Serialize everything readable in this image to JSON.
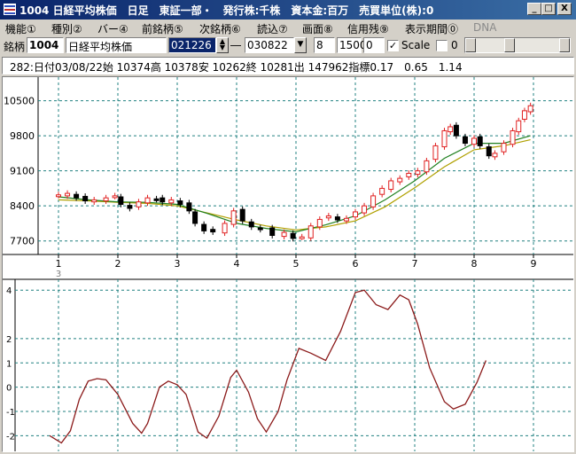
{
  "window": {
    "title": "1004 日経平均株価　日足　東証一部・　発行株:千株　資本金:百万　売買単位(株):0",
    "minimize": "_",
    "maximize": "□",
    "close": "X"
  },
  "menu": [
    {
      "label": "機能①",
      "disabled": false
    },
    {
      "label": "種別②",
      "disabled": false
    },
    {
      "label": "バー④",
      "disabled": false
    },
    {
      "label": "前銘柄⑤",
      "disabled": false
    },
    {
      "label": "次銘柄⑥",
      "disabled": false
    },
    {
      "label": "読込⑦",
      "disabled": false
    },
    {
      "label": "画面⑧",
      "disabled": false
    },
    {
      "label": "信用残⑨",
      "disabled": false
    },
    {
      "label": "表示期間⓪",
      "disabled": false
    },
    {
      "label": "DNA",
      "disabled": true
    }
  ],
  "toolbar": {
    "label": "銘柄",
    "code": "1004",
    "name": "日経平均株価",
    "start_date": "021226",
    "separator": "―",
    "end_date": "030822",
    "field_a": "8",
    "field_b": "1500",
    "field_c": "0",
    "scale_checked": "✓",
    "scale_label": "Scale",
    "zero_label": "0"
  },
  "info": {
    "text": "282:日付03/08/22始 10374高 10378安 10262終 10281出 147962指標0.17　0.65　1.14"
  },
  "chart_data": [
    {
      "type": "candlestick",
      "title": "",
      "y_ticks": [
        10500,
        9800,
        9100,
        8400,
        7700
      ],
      "ylim": [
        7500,
        10900
      ],
      "x_ticks": [
        "1",
        "2",
        "3",
        "4",
        "5",
        "6",
        "7",
        "8",
        "9"
      ],
      "x_sub_label": "3",
      "grid": true,
      "up_color": "#e02020",
      "down_color": "#000000",
      "ma_short_color": "#208020",
      "ma_long_color": "#b0a000",
      "close_points": [
        [
          0,
          8620
        ],
        [
          0.15,
          8650
        ],
        [
          0.3,
          8560
        ],
        [
          0.45,
          8500
        ],
        [
          0.6,
          8520
        ],
        [
          0.8,
          8560
        ],
        [
          0.95,
          8600
        ],
        [
          1.05,
          8430
        ],
        [
          1.2,
          8350
        ],
        [
          1.35,
          8480
        ],
        [
          1.5,
          8560
        ],
        [
          1.65,
          8530
        ],
        [
          1.75,
          8480
        ],
        [
          1.9,
          8520
        ],
        [
          2.05,
          8430
        ],
        [
          2.2,
          8300
        ],
        [
          2.3,
          8050
        ],
        [
          2.45,
          7900
        ],
        [
          2.6,
          7880
        ],
        [
          2.8,
          8050
        ],
        [
          2.95,
          8300
        ],
        [
          3.1,
          8100
        ],
        [
          3.25,
          7980
        ],
        [
          3.4,
          7930
        ],
        [
          3.6,
          7810
        ],
        [
          3.8,
          7870
        ],
        [
          3.95,
          7750
        ],
        [
          4.1,
          7780
        ],
        [
          4.25,
          8000
        ],
        [
          4.4,
          8130
        ],
        [
          4.55,
          8200
        ],
        [
          4.7,
          8120
        ],
        [
          4.85,
          8150
        ],
        [
          5.0,
          8280
        ],
        [
          5.15,
          8400
        ],
        [
          5.3,
          8600
        ],
        [
          5.45,
          8750
        ],
        [
          5.6,
          8900
        ],
        [
          5.75,
          8950
        ],
        [
          5.9,
          9050
        ],
        [
          6.05,
          9100
        ],
        [
          6.2,
          9300
        ],
        [
          6.35,
          9600
        ],
        [
          6.5,
          9900
        ],
        [
          6.6,
          9980
        ],
        [
          6.7,
          9800
        ],
        [
          6.85,
          9650
        ],
        [
          7.0,
          9750
        ],
        [
          7.1,
          9600
        ],
        [
          7.25,
          9400
        ],
        [
          7.35,
          9450
        ],
        [
          7.5,
          9650
        ],
        [
          7.65,
          9900
        ],
        [
          7.75,
          10100
        ],
        [
          7.85,
          10300
        ],
        [
          7.95,
          10400
        ]
      ],
      "ma_short_points": [
        [
          0,
          8580
        ],
        [
          0.5,
          8520
        ],
        [
          1.0,
          8480
        ],
        [
          1.5,
          8470
        ],
        [
          2.0,
          8430
        ],
        [
          2.5,
          8250
        ],
        [
          3.0,
          8050
        ],
        [
          3.5,
          7950
        ],
        [
          4.0,
          7880
        ],
        [
          4.5,
          8020
        ],
        [
          5.0,
          8200
        ],
        [
          5.5,
          8520
        ],
        [
          6.0,
          8900
        ],
        [
          6.5,
          9350
        ],
        [
          7.0,
          9650
        ],
        [
          7.5,
          9650
        ],
        [
          7.95,
          9800
        ]
      ],
      "ma_long_points": [
        [
          0,
          8520
        ],
        [
          0.5,
          8500
        ],
        [
          1.0,
          8470
        ],
        [
          1.5,
          8450
        ],
        [
          2.0,
          8400
        ],
        [
          2.5,
          8260
        ],
        [
          3.0,
          8120
        ],
        [
          3.5,
          8000
        ],
        [
          4.0,
          7920
        ],
        [
          4.5,
          7980
        ],
        [
          5.0,
          8100
        ],
        [
          5.5,
          8380
        ],
        [
          6.0,
          8760
        ],
        [
          6.5,
          9180
        ],
        [
          7.0,
          9520
        ],
        [
          7.5,
          9600
        ],
        [
          7.95,
          9720
        ]
      ]
    },
    {
      "type": "line",
      "title": "",
      "y_ticks": [
        4,
        2,
        1,
        0,
        -1,
        -2
      ],
      "ylim": [
        -2.5,
        4.3
      ],
      "grid": true,
      "line_color": "#8b1a1a",
      "points": [
        [
          -0.15,
          -2.0
        ],
        [
          0.05,
          -2.3
        ],
        [
          0.2,
          -1.8
        ],
        [
          0.35,
          -0.5
        ],
        [
          0.5,
          0.25
        ],
        [
          0.65,
          0.35
        ],
        [
          0.8,
          0.3
        ],
        [
          1.0,
          -0.3
        ],
        [
          1.25,
          -1.5
        ],
        [
          1.4,
          -1.9
        ],
        [
          1.5,
          -1.5
        ],
        [
          1.7,
          0.0
        ],
        [
          1.85,
          0.25
        ],
        [
          2.0,
          0.1
        ],
        [
          2.15,
          -0.3
        ],
        [
          2.35,
          -1.85
        ],
        [
          2.5,
          -2.1
        ],
        [
          2.7,
          -1.2
        ],
        [
          2.9,
          0.4
        ],
        [
          3.0,
          0.7
        ],
        [
          3.2,
          -0.2
        ],
        [
          3.35,
          -1.3
        ],
        [
          3.5,
          -1.85
        ],
        [
          3.7,
          -1.0
        ],
        [
          3.85,
          0.3
        ],
        [
          4.05,
          1.6
        ],
        [
          4.25,
          1.4
        ],
        [
          4.5,
          1.1
        ],
        [
          4.75,
          2.3
        ],
        [
          5.0,
          3.9
        ],
        [
          5.15,
          4.0
        ],
        [
          5.35,
          3.4
        ],
        [
          5.55,
          3.2
        ],
        [
          5.75,
          3.8
        ],
        [
          5.9,
          3.6
        ],
        [
          6.05,
          2.6
        ],
        [
          6.25,
          0.8
        ],
        [
          6.5,
          -0.6
        ],
        [
          6.65,
          -0.9
        ],
        [
          6.85,
          -0.7
        ],
        [
          7.05,
          0.2
        ],
        [
          7.2,
          1.1
        ]
      ]
    }
  ]
}
